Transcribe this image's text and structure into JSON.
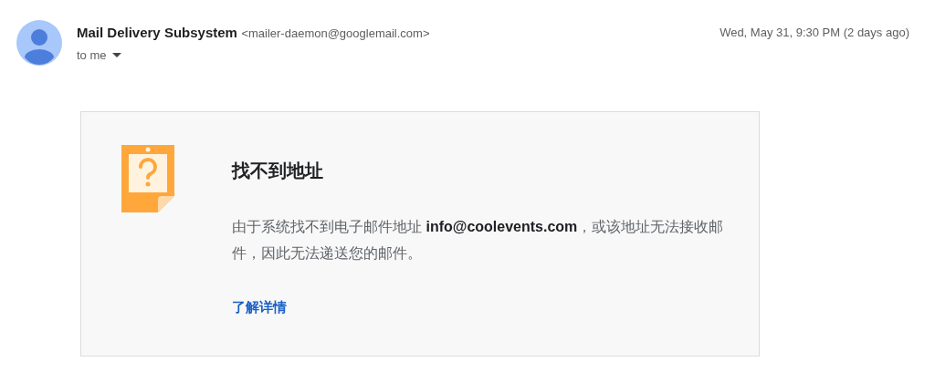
{
  "header": {
    "sender_name": "Mail Delivery Subsystem",
    "sender_email": "<mailer-daemon@googlemail.com>",
    "recipient": "to me",
    "date": "Wed, May 31, 9:30 PM (2 days ago)"
  },
  "notice": {
    "title": "找不到地址",
    "message": "由于系统找不到电子邮件地址 **info@coolevents.com**，或该地址无法接收邮件，因此无法递送您的邮件。",
    "link": "了解详情"
  }
}
